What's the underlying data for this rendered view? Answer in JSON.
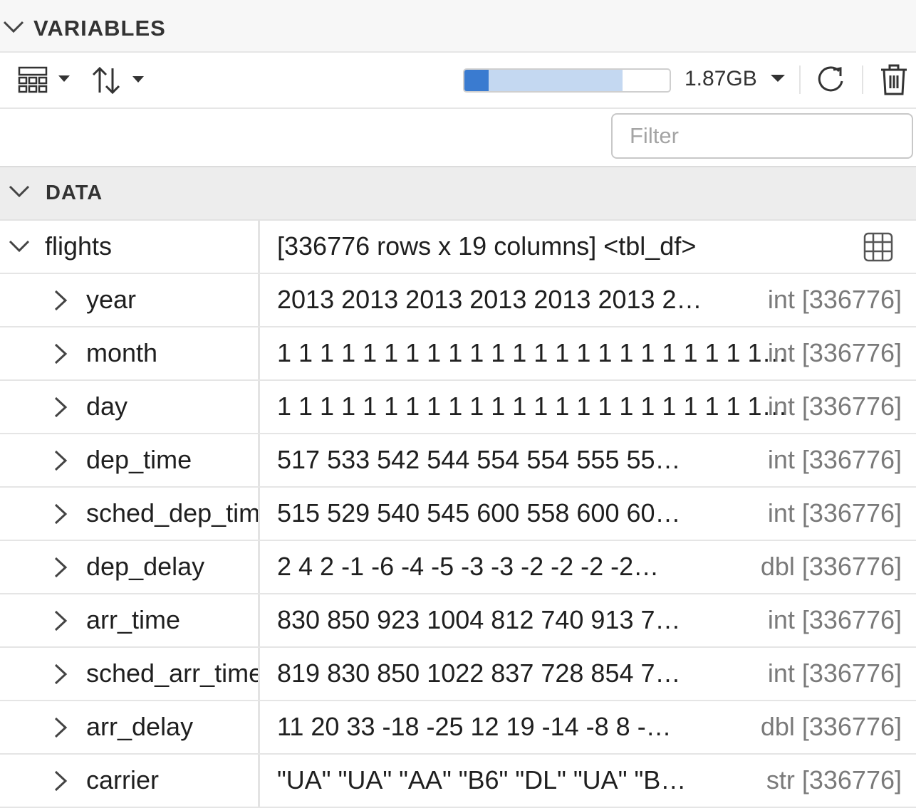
{
  "header": {
    "title": "VARIABLES"
  },
  "toolbar": {
    "layout_icon": "grid-layout-icon",
    "sort_icon": "sort-arrows-icon",
    "memory": {
      "label": "1.87GB",
      "used_fraction": 0.12,
      "available_fraction": 0.78
    },
    "refresh_icon": "refresh-icon",
    "delete_icon": "trash-icon"
  },
  "filter": {
    "placeholder": "Filter",
    "value": ""
  },
  "section": {
    "title": "DATA"
  },
  "parent": {
    "name": "flights",
    "value": "[336776 rows x 19 columns] <tbl_df>",
    "icon": "table-view-icon"
  },
  "rows": [
    {
      "name": "year",
      "value": "2013 2013 2013 2013 2013 2013 2…",
      "type": "int [336776]"
    },
    {
      "name": "month",
      "value": "1 1 1 1 1 1 1 1 1 1 1 1 1 1 1 1 1 1 1 1 1 1 1…",
      "type": "int [336776]"
    },
    {
      "name": "day",
      "value": "1 1 1 1 1 1 1 1 1 1 1 1 1 1 1 1 1 1 1 1 1 1 1…",
      "type": "int [336776]"
    },
    {
      "name": "dep_time",
      "value": "517 533 542 544 554 554 555 55…",
      "type": "int [336776]"
    },
    {
      "name": "sched_dep_time",
      "value": "515 529 540 545 600 558 600 60…",
      "type": "int [336776]"
    },
    {
      "name": "dep_delay",
      "value": "2 4 2 -1 -6 -4 -5 -3 -3 -2 -2 -2 -2…",
      "type": "dbl [336776]"
    },
    {
      "name": "arr_time",
      "value": "830 850 923 1004 812 740 913 7…",
      "type": "int [336776]"
    },
    {
      "name": "sched_arr_time",
      "value": "819 830 850 1022 837 728 854 7…",
      "type": "int [336776]"
    },
    {
      "name": "arr_delay",
      "value": "11 20 33 -18 -25 12 19 -14 -8 8 -…",
      "type": "dbl [336776]"
    },
    {
      "name": "carrier",
      "value": "\"UA\" \"UA\" \"AA\" \"B6\" \"DL\" \"UA\" \"B…",
      "type": "str [336776]"
    }
  ]
}
